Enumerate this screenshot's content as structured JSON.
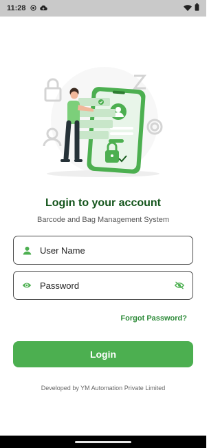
{
  "status_bar": {
    "time": "11:28",
    "left_icons": [
      "record-icon",
      "cloud-icon"
    ],
    "right_icons": [
      "wifi-icon",
      "battery-icon"
    ]
  },
  "login": {
    "title": "Login to your account",
    "subtitle": "Barcode and Bag Management System",
    "username_placeholder": "User Name",
    "password_placeholder": "Password",
    "forgot_password": "Forgot Password?",
    "login_button": "Login",
    "footer": "Developed by YM Automation Private Limited"
  },
  "colors": {
    "primary": "#4caf50",
    "title": "#12541a",
    "link": "#2e8b3a"
  }
}
